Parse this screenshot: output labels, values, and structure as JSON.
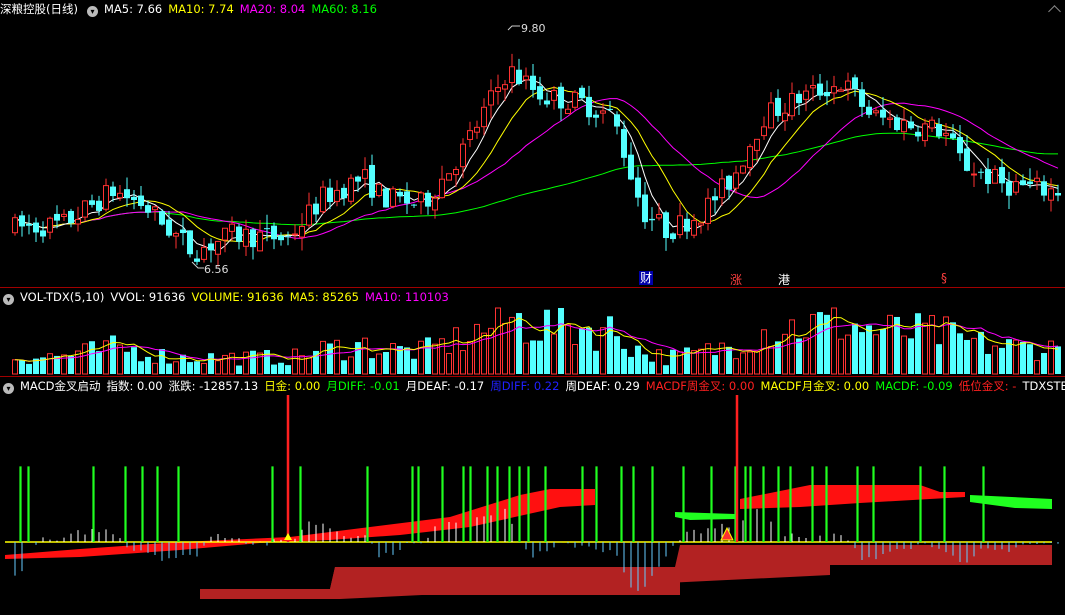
{
  "main": {
    "title": "深粮控股(日线)",
    "ma5": "MA5: 7.66",
    "ma10": "MA10: 7.74",
    "ma20": "MA20: 8.04",
    "ma60": "MA60: 8.16",
    "high_label": "9.80",
    "low_label": "6.56",
    "events": [
      "财",
      "涨",
      "港",
      "§"
    ]
  },
  "volume": {
    "title": "VOL-TDX(5,10)",
    "vvol": "VVOL: 91636",
    "volume": "VOLUME: 91636",
    "ma5": "MA5: 85265",
    "ma10": "MA10: 110103"
  },
  "macd": {
    "title": "MACD金叉启动",
    "zhishu": "指数: 0.00",
    "zhangdie": "涨跌: -12857.13",
    "rijin": "日金: 0.00",
    "yue_diff": "月DIFF: -0.01",
    "yue_deaf": "月DEAF: -0.17",
    "zhou_diff": "周DIFF: 0.22",
    "zhou_deaf": "周DEAF: 0.29",
    "macdf_zhou": "MACDF周金叉: 0.00",
    "macdf_yue": "MACDF月金叉: 0.00",
    "macdf": "MACDF: -0.09",
    "diwei": "低位金叉: -",
    "tdx": "TDXSTEP282"
  },
  "colors": {
    "up": "#ff3232",
    "down": "#54ffff",
    "ma5": "#ffffff",
    "ma10": "#ffff00",
    "ma20": "#ff00ff",
    "ma60": "#00ff00"
  },
  "chart_data": {
    "type": "candlestick",
    "price_range": [
      6.4,
      10.1
    ],
    "high_marker": 9.8,
    "low_marker": 6.56,
    "last_ma": {
      "MA5": 7.66,
      "MA10": 7.74,
      "MA20": 8.04,
      "MA60": 8.16
    },
    "last_volume": 91636,
    "last_vol_ma": {
      "MA5": 85265,
      "MA10": 110103
    }
  }
}
